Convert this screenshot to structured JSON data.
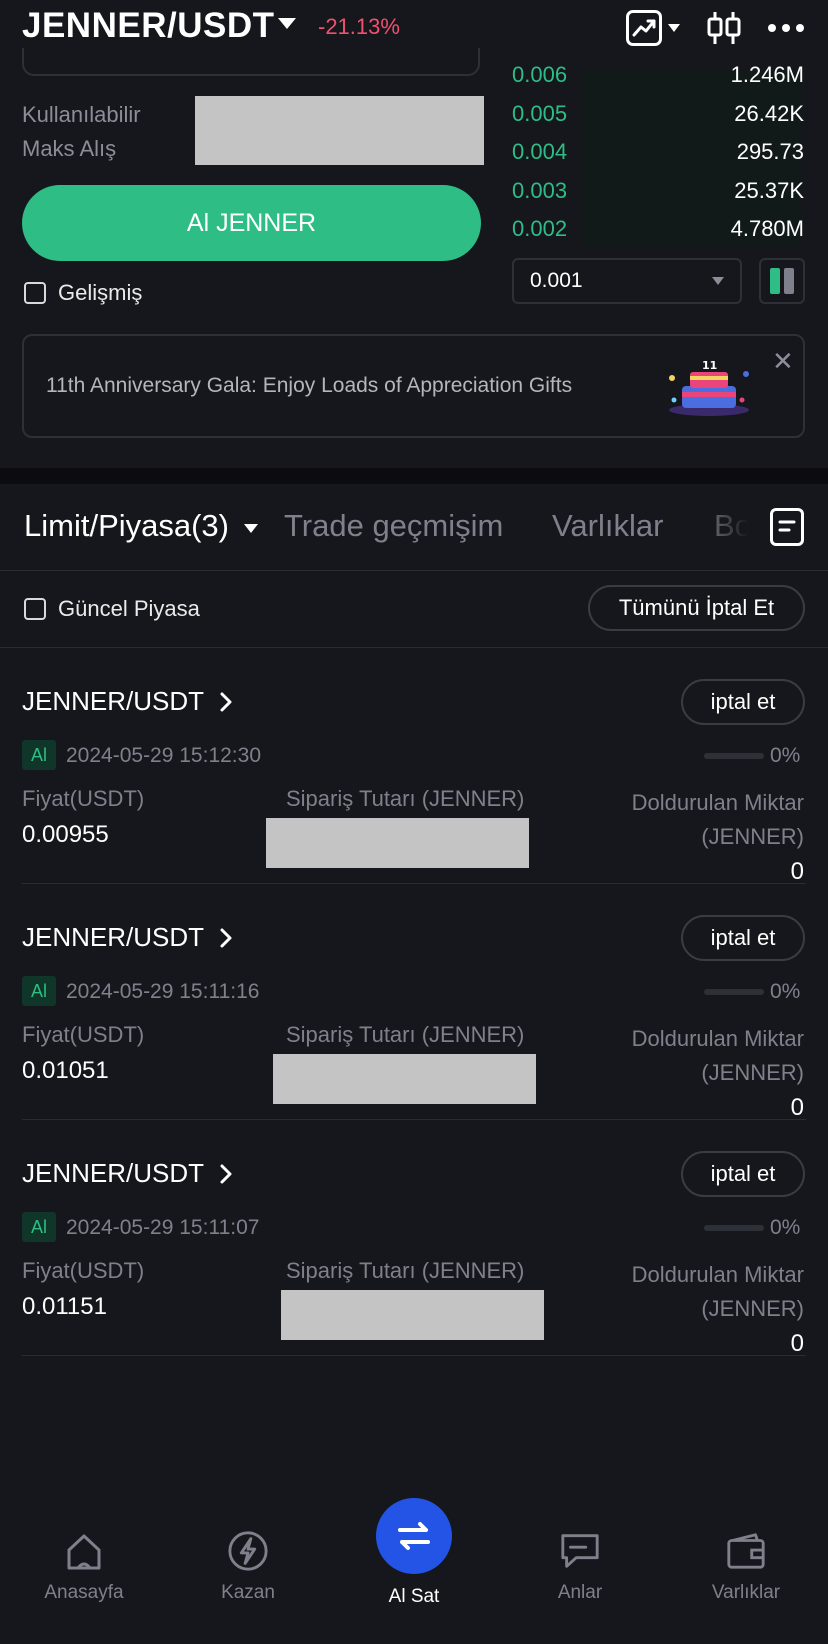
{
  "header": {
    "pair": "JENNER/USDT",
    "change": "-21.13%"
  },
  "trade_form": {
    "available_label_1": "Kullanılabilir",
    "available_label_2": "Maks Alış",
    "buy_button": "Al JENNER",
    "advanced_label": "Gelişmiş"
  },
  "order_book": {
    "rows": [
      {
        "price": "0.006",
        "amount": "1.246M"
      },
      {
        "price": "0.005",
        "amount": "26.42K"
      },
      {
        "price": "0.004",
        "amount": "295.73"
      },
      {
        "price": "0.003",
        "amount": "25.37K"
      },
      {
        "price": "0.002",
        "amount": "4.780M"
      }
    ],
    "tick_size": "0.001"
  },
  "banner": {
    "text": "11th Anniversary Gala: Enjoy Loads of Appreciation Gifts"
  },
  "tabs": [
    {
      "label": "Limit/Piyasa(3)"
    },
    {
      "label": "Trade geçmişim"
    },
    {
      "label": "Varlıklar"
    },
    {
      "label": "Bo"
    }
  ],
  "filters": {
    "current_market_label": "Güncel Piyasa",
    "cancel_all": "Tümünü İptal Et"
  },
  "orders": [
    {
      "pair": "JENNER/USDT",
      "cancel": "iptal et",
      "side": "Al",
      "time": "2024-05-29 15:12:30",
      "progress": "0%",
      "progress_value": 0,
      "price_label": "Fiyat(USDT)",
      "price": "0.00955",
      "amount_label": "Sipariş Tutarı (JENNER)",
      "filled_label_1": "Doldurulan Miktar",
      "filled_label_2": "(JENNER)",
      "filled": "0"
    },
    {
      "pair": "JENNER/USDT",
      "cancel": "iptal et",
      "side": "Al",
      "time": "2024-05-29 15:11:16",
      "progress": "0%",
      "progress_value": 0,
      "price_label": "Fiyat(USDT)",
      "price": "0.01051",
      "amount_label": "Sipariş Tutarı (JENNER)",
      "filled_label_1": "Doldurulan Miktar",
      "filled_label_2": "(JENNER)",
      "filled": "0"
    },
    {
      "pair": "JENNER/USDT",
      "cancel": "iptal et",
      "side": "Al",
      "time": "2024-05-29 15:11:07",
      "progress": "0%",
      "progress_value": 0,
      "price_label": "Fiyat(USDT)",
      "price": "0.01151",
      "amount_label": "Sipariş Tutarı (JENNER)",
      "filled_label_1": "Doldurulan Miktar",
      "filled_label_2": "(JENNER)",
      "filled": "0"
    }
  ],
  "bottom_nav": [
    {
      "label": "Anasayfa",
      "icon": "home-icon"
    },
    {
      "label": "Kazan",
      "icon": "earn-icon"
    },
    {
      "label": "Al Sat",
      "icon": "swap-icon"
    },
    {
      "label": "Anlar",
      "icon": "moments-icon"
    },
    {
      "label": "Varlıklar",
      "icon": "wallet-icon"
    }
  ],
  "colors": {
    "background": "#16171c",
    "buy_green": "#2ebd85",
    "sell_red": "#f0506e",
    "nav_active": "#2354e6"
  }
}
